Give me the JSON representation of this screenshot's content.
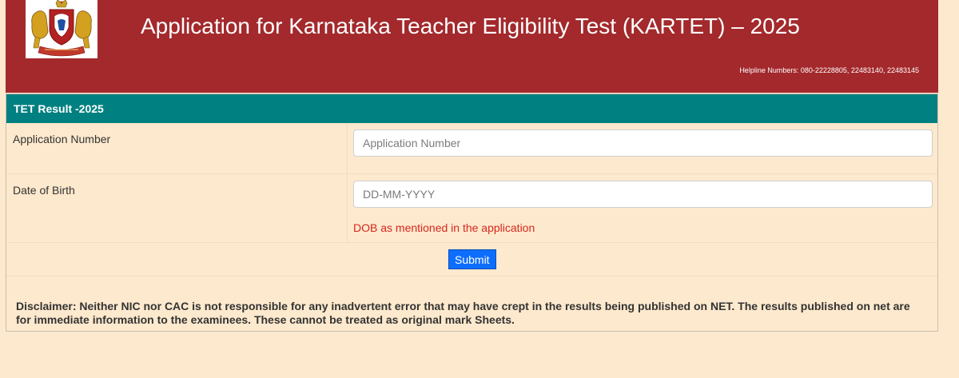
{
  "header": {
    "title": "Application for Karnataka Teacher Eligibility Test (KARTET) – 2025",
    "helpline": "Helpline Numbers: 080-22228805, 22483140, 22483145",
    "emblem_icon": "karnataka-emblem-icon",
    "background_color": "#a3292c"
  },
  "form": {
    "panel_title": "TET Result -2025",
    "panel_color": "#008080",
    "application_number": {
      "label": "Application Number",
      "placeholder": "Application Number",
      "value": ""
    },
    "date_of_birth": {
      "label": "Date of Birth",
      "placeholder": "DD-MM-YYYY",
      "value": "",
      "hint": "DOB as mentioned in the application"
    },
    "submit_label": "Submit"
  },
  "disclaimer": "Disclaimer: Neither NIC nor CAC is not responsible for any inadvertent error that may have crept in the results being published on NET. The results published on net are for immediate information to the examinees. These cannot be treated as original mark Sheets."
}
